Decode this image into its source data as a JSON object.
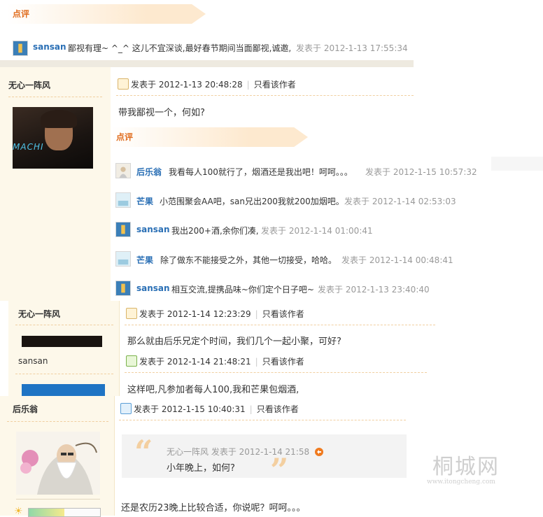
{
  "top_comments": {
    "tag": "点评",
    "item": {
      "user": "sansan",
      "text": "鄙视有理~ ^_^ 这儿不宜深谈,最好春节期间当面鄙视,诚邀,",
      "time": "发表于 2012-1-13 17:55:34"
    }
  },
  "post1": {
    "author": "无心一阵风",
    "meta": "发表于 2012-1-13 20:48:28",
    "only_author": "只看该作者",
    "avatar_text": "MACHI",
    "content": "带我鄙视一个，何如?",
    "comments_tag": "点评",
    "comments": [
      {
        "user": "后乐翁",
        "text": "我看每人100就行了，烟酒还是我出吧！呵呵。。。",
        "time": "发表于 2012-1-15 10:57:32"
      },
      {
        "user": "芒果",
        "text": "小范围聚会AA吧，san兄出200我就200加烟吧。",
        "time": "发表于 2012-1-14 02:53:03"
      },
      {
        "user": "sansan",
        "text": "我出200+酒,余你们凑,",
        "time": "发表于 2012-1-14 01:00:41"
      },
      {
        "user": "芒果",
        "text": "除了做东不能接受之外，其他一切接受，哈哈。",
        "time": "发表于 2012-1-14 00:48:41"
      },
      {
        "user": "sansan",
        "text": "相互交流,提携品味~你们定个日子吧~",
        "time": "发表于 2012-1-13 23:40:40"
      }
    ]
  },
  "post2": {
    "author": "无心一阵风",
    "meta": "发表于 2012-1-14 12:23:29",
    "only_author": "只看该作者",
    "content": "那么就由后乐兄定个时间，我们几个一起小聚，可好?"
  },
  "post3": {
    "author": "sansan",
    "meta": "发表于 2012-1-14 21:48:21",
    "only_author": "只看该作者",
    "content": "这样吧,凡参加者每人100,我和芒果包烟酒,"
  },
  "post4": {
    "author": "后乐翁",
    "meta": "发表于 2012-1-15 10:40:31",
    "only_author": "只看该作者",
    "quote_head": "无心一阵风 发表于 2012-1-14 21:58",
    "quote_body": "小年晚上，如何?",
    "content": "还是农历23晚上比较合适，你说呢？呵呵。。。"
  },
  "watermark": {
    "title": "桐城网",
    "url": "www.itongcheng.com"
  },
  "colors": {
    "accent_orange": "#e06d1f",
    "username_blue": "#2a6fb5",
    "sidebar_bg": "#fdf8ea",
    "tag_bg": "#fde9cf"
  }
}
